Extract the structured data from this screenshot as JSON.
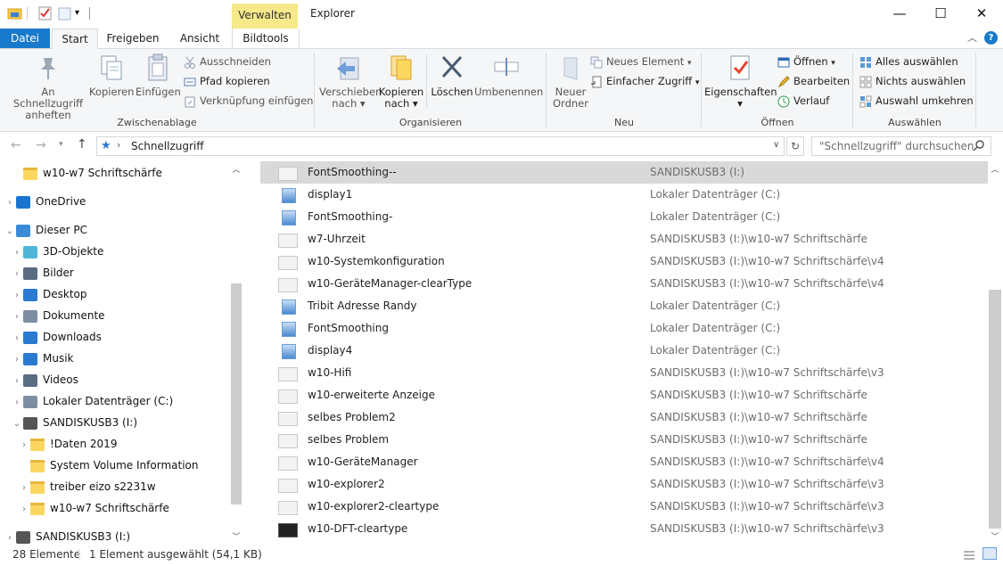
{
  "title_bar": {
    "context_tab": "Verwalten",
    "app_title": "Explorer",
    "window_buttons": [
      "minimize",
      "maximize",
      "close"
    ]
  },
  "tabs": {
    "datei": "Datei",
    "start": "Start",
    "freigeben": "Freigeben",
    "ansicht": "Ansicht",
    "bildtools": "Bildtools"
  },
  "ribbon": {
    "zwischenablage": {
      "label": "Zwischenablage",
      "pin": "An Schnellzugriff anheften",
      "pin_l1": "An Schnellzugriff",
      "pin_l2": "anheften",
      "copy": "Kopieren",
      "paste": "Einfügen",
      "cut": "Ausschneiden",
      "copy_path": "Pfad kopieren",
      "paste_shortcut": "Verknüpfung einfügen"
    },
    "organisieren": {
      "label": "Organisieren",
      "move_l1": "Verschieben",
      "move_l2": "nach",
      "copyto_l1": "Kopieren",
      "copyto_l2": "nach",
      "delete": "Löschen",
      "rename": "Umbenennen"
    },
    "neu": {
      "label": "Neu",
      "new_folder_l1": "Neuer",
      "new_folder_l2": "Ordner",
      "new_item": "Neues Element",
      "easy_access": "Einfacher Zugriff"
    },
    "oeffnen": {
      "label": "Öffnen",
      "properties": "Eigenschaften",
      "open": "Öffnen",
      "edit": "Bearbeiten",
      "history": "Verlauf"
    },
    "auswaehlen": {
      "label": "Auswählen",
      "select_all": "Alles auswählen",
      "select_none": "Nichts auswählen",
      "invert": "Auswahl umkehren"
    }
  },
  "address": {
    "path": "Schnellzugriff",
    "search_placeholder": "\"Schnellzugriff\" durchsuchen"
  },
  "nav": [
    {
      "label": "w10-w7 Schriftschärfe",
      "indent": 1,
      "chev": "",
      "icon": "folder-icon"
    },
    {
      "label": "OneDrive",
      "indent": 0,
      "chev": ">",
      "icon": "onedrive-icon"
    },
    {
      "label": "Dieser PC",
      "indent": 0,
      "chev": "v",
      "icon": "pc-icon"
    },
    {
      "label": "3D-Objekte",
      "indent": 1,
      "chev": ">",
      "icon": "3d-objects-icon"
    },
    {
      "label": "Bilder",
      "indent": 1,
      "chev": ">",
      "icon": "pictures-icon"
    },
    {
      "label": "Desktop",
      "indent": 1,
      "chev": ">",
      "icon": "desktop-icon"
    },
    {
      "label": "Dokumente",
      "indent": 1,
      "chev": ">",
      "icon": "documents-icon"
    },
    {
      "label": "Downloads",
      "indent": 1,
      "chev": ">",
      "icon": "downloads-icon"
    },
    {
      "label": "Musik",
      "indent": 1,
      "chev": ">",
      "icon": "music-icon"
    },
    {
      "label": "Videos",
      "indent": 1,
      "chev": ">",
      "icon": "videos-icon"
    },
    {
      "label": "Lokaler Datenträger (C:)",
      "indent": 1,
      "chev": ">",
      "icon": "drive-c-icon"
    },
    {
      "label": "SANDISKUSB3 (I:)",
      "indent": 1,
      "chev": "v",
      "icon": "usb-drive-icon"
    },
    {
      "label": "!Daten 2019",
      "indent": 2,
      "chev": ">",
      "icon": "folder-icon"
    },
    {
      "label": "System Volume Information",
      "indent": 2,
      "chev": "",
      "icon": "folder-icon"
    },
    {
      "label": "treiber eizo s2231w",
      "indent": 2,
      "chev": ">",
      "icon": "folder-icon"
    },
    {
      "label": "w10-w7 Schriftschärfe",
      "indent": 2,
      "chev": ">",
      "icon": "folder-icon"
    },
    {
      "label": "SANDISKUSB3 (I:)",
      "indent": 0,
      "chev": ">",
      "icon": "usb-drive-icon"
    }
  ],
  "files": [
    {
      "name": "FontSmoothing--",
      "location": "SANDISKUSB3 (I:)",
      "thumb": "gray",
      "selected": true
    },
    {
      "name": "display1",
      "location": "Lokaler Datenträger (C:)",
      "thumb": "img"
    },
    {
      "name": "FontSmoothing-",
      "location": "Lokaler Datenträger (C:)",
      "thumb": "img"
    },
    {
      "name": "w7-Uhrzeit",
      "location": "SANDISKUSB3 (I:)\\w10-w7 Schriftschärfe",
      "thumb": "gray"
    },
    {
      "name": "w10-Systemkonfiguration",
      "location": "SANDISKUSB3 (I:)\\w10-w7 Schriftschärfe\\v4",
      "thumb": "gray"
    },
    {
      "name": "w10-GeräteManager-clearType",
      "location": "SANDISKUSB3 (I:)\\w10-w7 Schriftschärfe\\v4",
      "thumb": "gray"
    },
    {
      "name": "Tribit Adresse Randy",
      "location": "Lokaler Datenträger (C:)",
      "thumb": "img"
    },
    {
      "name": "FontSmoothing",
      "location": "Lokaler Datenträger (C:)",
      "thumb": "img"
    },
    {
      "name": "display4",
      "location": "Lokaler Datenträger (C:)",
      "thumb": "img"
    },
    {
      "name": "w10-Hifi",
      "location": "SANDISKUSB3 (I:)\\w10-w7 Schriftschärfe\\v3",
      "thumb": "gray"
    },
    {
      "name": "w10-erweiterte Anzeige",
      "location": "SANDISKUSB3 (I:)\\w10-w7 Schriftschärfe",
      "thumb": "gray"
    },
    {
      "name": "selbes Problem2",
      "location": "SANDISKUSB3 (I:)\\w10-w7 Schriftschärfe",
      "thumb": "gray"
    },
    {
      "name": "selbes Problem",
      "location": "SANDISKUSB3 (I:)\\w10-w7 Schriftschärfe",
      "thumb": "gray"
    },
    {
      "name": "w10-GeräteManager",
      "location": "SANDISKUSB3 (I:)\\w10-w7 Schriftschärfe\\v4",
      "thumb": "gray"
    },
    {
      "name": "w10-explorer2",
      "location": "SANDISKUSB3 (I:)\\w10-w7 Schriftschärfe\\v3",
      "thumb": "gray"
    },
    {
      "name": "w10-explorer2-cleartype",
      "location": "SANDISKUSB3 (I:)\\w10-w7 Schriftschärfe\\v3",
      "thumb": "gray"
    },
    {
      "name": "w10-DFT-cleartype",
      "location": "SANDISKUSB3 (I:)\\w10-w7 Schriftschärfe\\v3",
      "thumb": "dark"
    }
  ],
  "status": {
    "count": "28 Elemente",
    "selection": "1 Element ausgewählt (54,1 KB)"
  },
  "colors": {
    "accent": "#1979ca",
    "context_tab": "#f5e98a",
    "selected_row": "#d9d9d9"
  }
}
